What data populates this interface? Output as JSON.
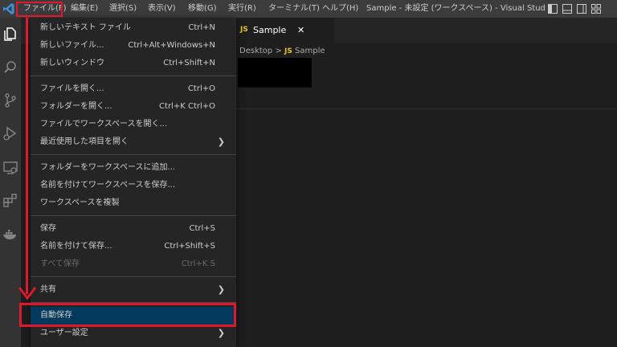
{
  "titlebar": {
    "menus": [
      "ファイル(F)",
      "編集(E)",
      "選択(S)",
      "表示(V)",
      "移動(G)",
      "実行(R)",
      "ターミナル(T)",
      "ヘルプ(H)"
    ],
    "title": "Sample - 未設定 (ワークスペース) - Visual Studio ..."
  },
  "tab": {
    "icon": "JS",
    "label": "Sample",
    "close": "✕"
  },
  "breadcrumb": {
    "folder": "Desktop",
    "sep": ">",
    "icon": "JS",
    "file": "Sample"
  },
  "menu": {
    "items": [
      {
        "label": "新しいテキスト ファイル",
        "shortcut": "Ctrl+N"
      },
      {
        "label": "新しいファイル...",
        "shortcut": "Ctrl+Alt+Windows+N"
      },
      {
        "label": "新しいウィンドウ",
        "shortcut": "Ctrl+Shift+N"
      },
      {
        "label": "ファイルを開く...",
        "shortcut": "Ctrl+O"
      },
      {
        "label": "フォルダーを開く...",
        "shortcut": "Ctrl+K Ctrl+O"
      },
      {
        "label": "ファイルでワークスペースを開く...",
        "shortcut": ""
      },
      {
        "label": "最近使用した項目を開く",
        "shortcut": "",
        "submenu": "❯"
      },
      {
        "label": "フォルダーをワークスペースに追加...",
        "shortcut": ""
      },
      {
        "label": "名前を付けてワークスペースを保存...",
        "shortcut": ""
      },
      {
        "label": "ワークスペースを複製",
        "shortcut": ""
      },
      {
        "label": "保存",
        "shortcut": "Ctrl+S"
      },
      {
        "label": "名前を付けて保存...",
        "shortcut": "Ctrl+Shift+S"
      },
      {
        "label": "すべて保存",
        "shortcut": "Ctrl+K S",
        "disabled": true
      },
      {
        "label": "共有",
        "shortcut": "",
        "submenu": "❯"
      },
      {
        "label": "自動保存",
        "shortcut": "",
        "highlighted": true
      },
      {
        "label": "ユーザー設定",
        "shortcut": "",
        "submenu": "❯"
      }
    ]
  },
  "colors": {
    "annotation_red": "#e0182d",
    "highlight": "#04395e",
    "js_yellow": "#e6c229",
    "vscode_blue": "#3e8fd6"
  },
  "icons": {
    "logo": "vscode-logo-icon",
    "activity": [
      "explorer-icon",
      "search-icon",
      "source-control-icon",
      "run-debug-icon",
      "remote-explorer-icon",
      "extensions-icon",
      "docker-icon"
    ]
  }
}
